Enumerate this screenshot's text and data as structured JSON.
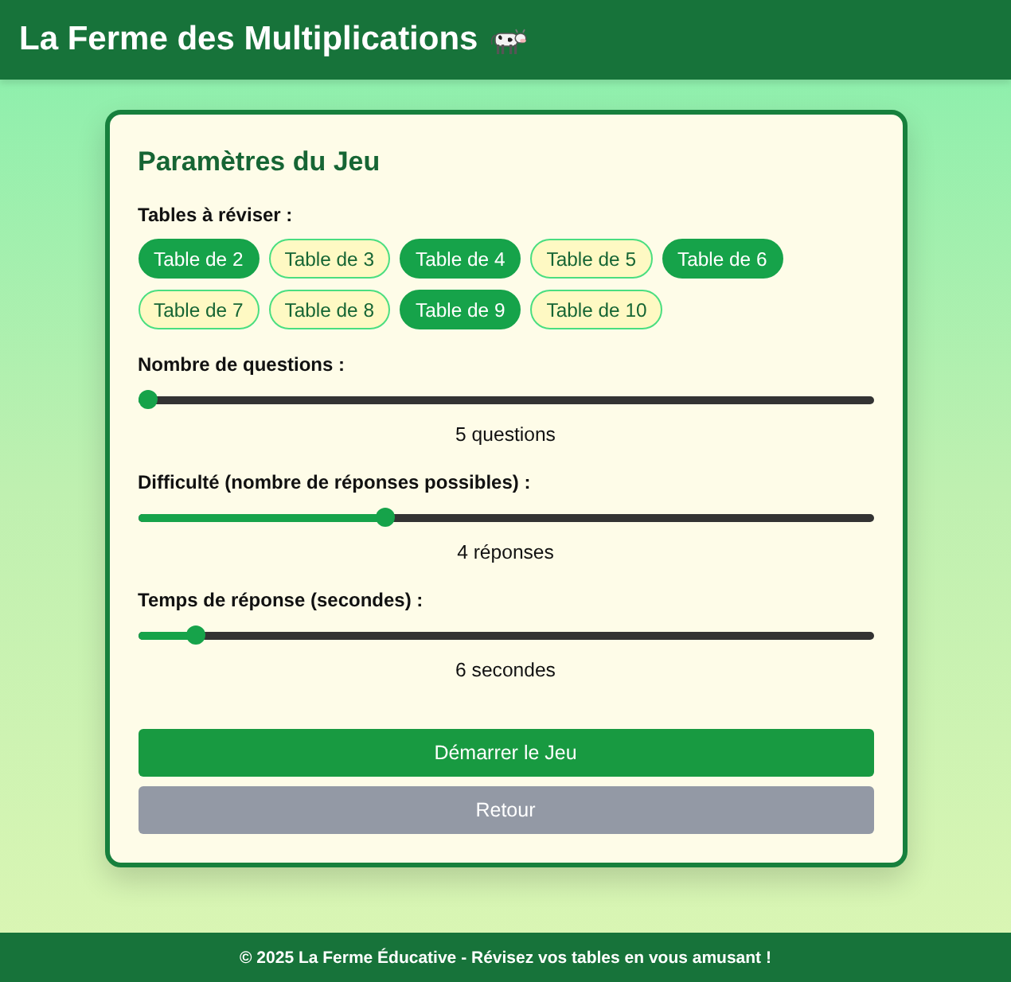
{
  "header": {
    "title": "La Ferme des Multiplications"
  },
  "settings": {
    "title": "Paramètres du Jeu",
    "tables_label": "Tables à réviser :",
    "tables": [
      {
        "label": "Table de 2",
        "selected": true
      },
      {
        "label": "Table de 3",
        "selected": false
      },
      {
        "label": "Table de 4",
        "selected": true
      },
      {
        "label": "Table de 5",
        "selected": false
      },
      {
        "label": "Table de 6",
        "selected": true
      },
      {
        "label": "Table de 7",
        "selected": false
      },
      {
        "label": "Table de 8",
        "selected": false
      },
      {
        "label": "Table de 9",
        "selected": true
      },
      {
        "label": "Table de 10",
        "selected": false
      }
    ],
    "sliders": [
      {
        "label": "Nombre de questions :",
        "level": 0,
        "reading": "5 questions"
      },
      {
        "label": "Difficulté (nombre de réponses possibles) :",
        "level": 0.333,
        "reading": "4 réponses"
      },
      {
        "label": "Temps de réponse (secondes) :",
        "level": 0.067,
        "reading": "6 secondes"
      }
    ],
    "buttons": [
      {
        "label": "Démarrer le Jeu",
        "kind": "primary"
      },
      {
        "label": "Retour",
        "kind": "secondary"
      }
    ]
  },
  "footer": {
    "text": "© 2025 La Ferme Éducative - Révisez vos tables en vous amusant !"
  }
}
